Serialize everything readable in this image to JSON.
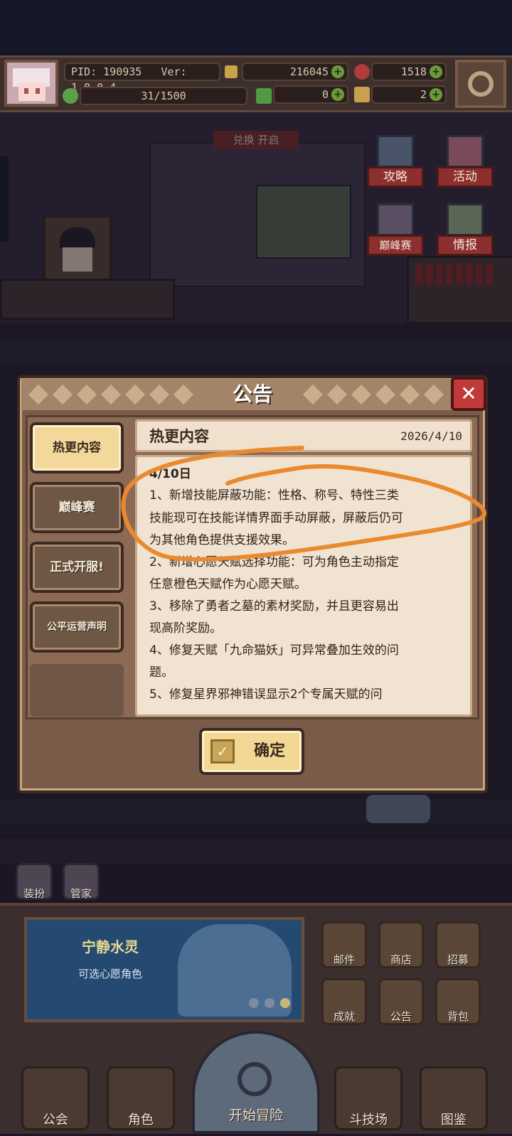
{
  "topbar": {
    "pid": "PID: 190935",
    "version": "Ver: 1.0.0.4",
    "gold": "216045",
    "gems": "1518",
    "stamina": "31/1500",
    "clover": "0",
    "keys": "2"
  },
  "side_menu": {
    "guide": "攻略",
    "events": "活动",
    "peak": "巅峰赛",
    "intel": "情报"
  },
  "background_banner": "兑换   开启",
  "modal": {
    "title": "公告",
    "close_icon": "✕",
    "tabs": [
      {
        "label": "热更内容",
        "active": true
      },
      {
        "label": "巅峰赛",
        "active": false
      },
      {
        "label": "正式开服!",
        "active": false
      },
      {
        "label": "公平运营声明",
        "active": false
      }
    ],
    "content_title": "热更内容",
    "content_date": "2026/4/10",
    "lines": [
      "4/10日",
      "1、新增技能屏蔽功能：性格、称号、特性三类",
      "技能现可在技能详情界面手动屏蔽，屏蔽后仍可",
      "为其他角色提供支援效果。",
      "2、新增心愿天赋选择功能：可为角色主动指定",
      "任意橙色天赋作为心愿天赋。",
      "3、移除了勇者之墓的素材奖励，并且更容易出",
      "现高阶奖励。",
      "4、修复天赋「九命猫妖」可异常叠加生效的问",
      "题。",
      "5、修复星界邪神错误显示2个专属天赋的问"
    ],
    "confirm": "确定",
    "annotation_color": "#e98a2e"
  },
  "bottom": {
    "dress": "装扮",
    "butler": "管家",
    "feature_title": "宁静水灵",
    "feature_sub": "可选心愿角色",
    "mail": "邮件",
    "shop": "商店",
    "recruit": "招募",
    "achievements": "成就",
    "notice": "公告",
    "bag": "背包"
  },
  "nav": {
    "guild": "公会",
    "character": "角色",
    "start": "开始冒险",
    "arena": "斗技场",
    "codex": "图鉴"
  }
}
